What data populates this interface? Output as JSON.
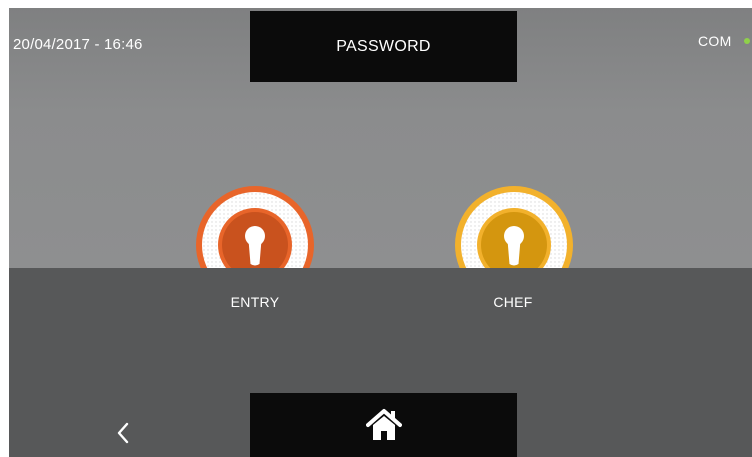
{
  "header": {
    "datetime": "20/04/2017 - 16:46",
    "title": "PASSWORD",
    "status": {
      "label": "COM",
      "dot_color": "#8fd14a"
    }
  },
  "locks": [
    {
      "label": "ENTRY",
      "icon": "keyhole-icon",
      "color": "#e8652a",
      "inner_color": "#c9521e"
    },
    {
      "label": "CHEF",
      "icon": "keyhole-icon",
      "color": "#f2b12c",
      "inner_color": "#d4960f"
    }
  ],
  "footer": {
    "back_icon": "chevron-left-icon",
    "home_icon": "home-icon"
  },
  "colors": {
    "upper_background": "#8c8d8e",
    "lower_background": "#575859",
    "bar_background": "#0b0b0b"
  }
}
